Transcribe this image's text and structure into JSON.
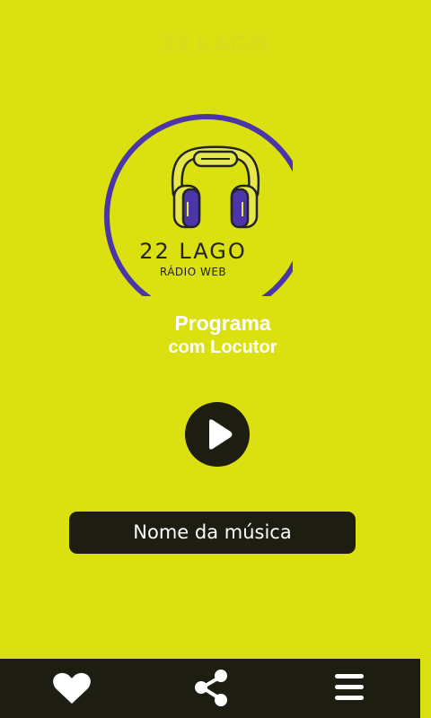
{
  "header": {
    "title": "22 LAGO"
  },
  "logo": {
    "name": "22 LAGO",
    "tagline": "RÁDIO WEB"
  },
  "program": {
    "title": "Programa",
    "subtitle": "com Locutor"
  },
  "player": {
    "play_icon": "play-icon",
    "song_name": "Nome da música"
  },
  "bottom_nav": {
    "items": [
      {
        "icon": "heart-icon"
      },
      {
        "icon": "share-icon"
      },
      {
        "icon": "menu-icon"
      }
    ]
  },
  "colors": {
    "background": "#dbe010",
    "dark": "#1d1d12",
    "ring": "#4b35a8",
    "headphone_yellow": "#e6e84a",
    "text_light": "#ffffff"
  }
}
